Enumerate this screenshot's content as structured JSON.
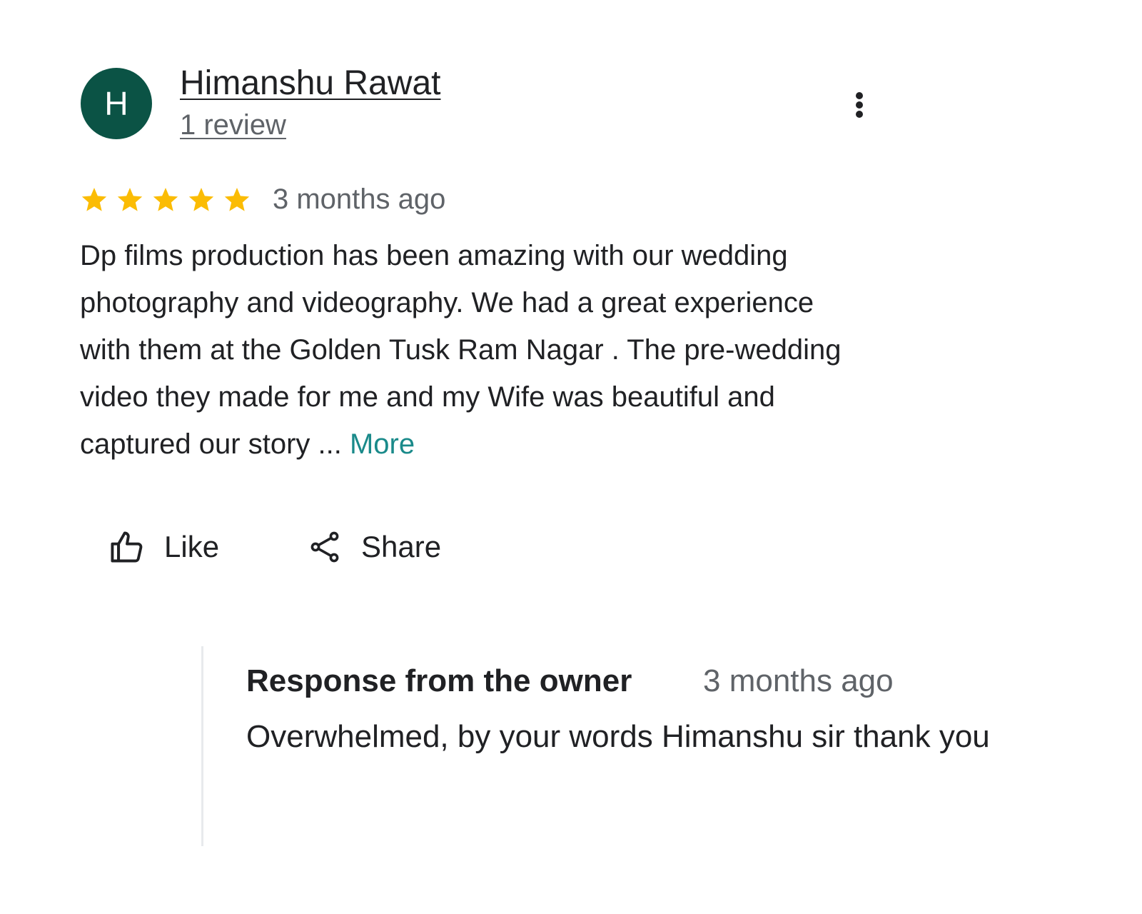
{
  "reviewer": {
    "initial": "H",
    "avatar_color": "#0b5345",
    "name": "Himanshu Rawat",
    "review_count": "1 review"
  },
  "menu": {
    "icon": "more-vert-icon"
  },
  "rating": {
    "stars": 5,
    "max_stars": 5,
    "star_color": "#fbbc04",
    "date": "3 months ago"
  },
  "review": {
    "text": "Dp films production has been amazing with our wedding photography and videography. We had a great experience with them at the Golden Tusk Ram Nagar . The pre-wedding video they made for me and my Wife was beautiful and captured our story ... ",
    "more_label": "More",
    "more_color": "#1a8a8a"
  },
  "actions": {
    "like_label": "Like",
    "like_icon": "thumbs-up-icon",
    "share_label": "Share",
    "share_icon": "share-icon"
  },
  "owner_response": {
    "title": "Response from the owner",
    "date": "3 months ago",
    "text": "Overwhelmed, by your words Himanshu sir thank you"
  }
}
